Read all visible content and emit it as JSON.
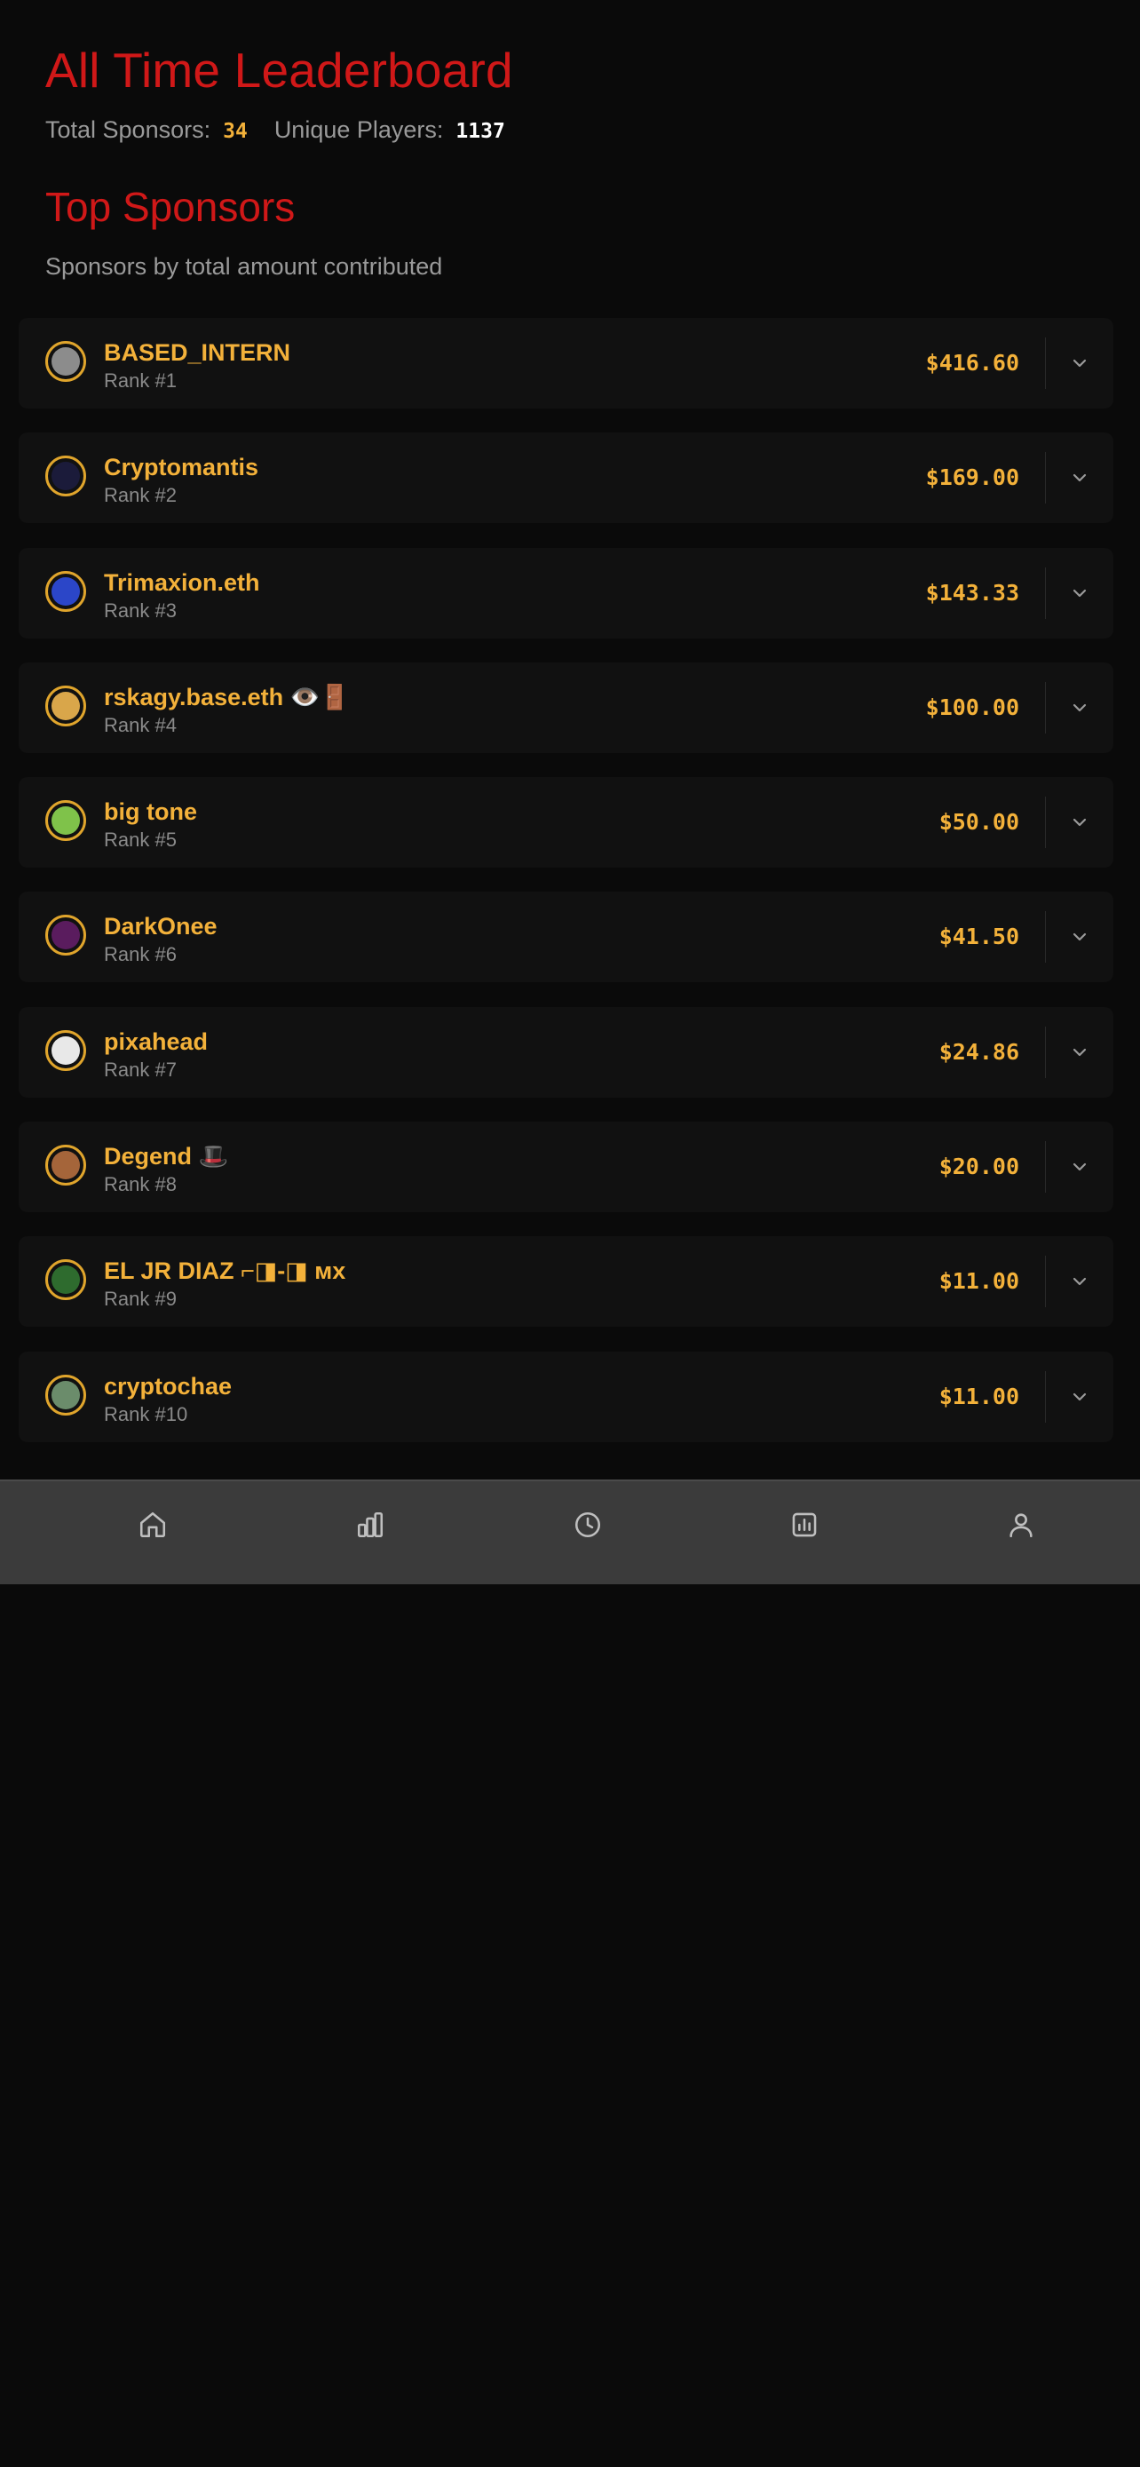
{
  "header": {
    "title": "All Time Leaderboard",
    "total_sponsors_label": "Total Sponsors:",
    "total_sponsors_value": "34",
    "unique_players_label": "Unique Players:",
    "unique_players_value": "1137"
  },
  "section": {
    "title": "Top Sponsors",
    "subtitle": "Sponsors by total amount contributed"
  },
  "sponsors": [
    {
      "name": "BASED_INTERN",
      "rank": "Rank #1",
      "amount": "$416.60",
      "avatar_color": "#8c8c8c"
    },
    {
      "name": "Cryptomantis",
      "rank": "Rank #2",
      "amount": "$169.00",
      "avatar_color": "#1b1b3a"
    },
    {
      "name": "Trimaxion.eth",
      "rank": "Rank #3",
      "amount": "$143.33",
      "avatar_color": "#2b46c8"
    },
    {
      "name": "rskagy.base.eth 👁️🚪",
      "rank": "Rank #4",
      "amount": "$100.00",
      "avatar_color": "#d9a64a"
    },
    {
      "name": "big tone",
      "rank": "Rank #5",
      "amount": "$50.00",
      "avatar_color": "#7fc24a"
    },
    {
      "name": "DarkOnee",
      "rank": "Rank #6",
      "amount": "$41.50",
      "avatar_color": "#5a1c5e"
    },
    {
      "name": "pixahead",
      "rank": "Rank #7",
      "amount": "$24.86",
      "avatar_color": "#e8e8e8"
    },
    {
      "name": "Degend 🎩",
      "rank": "Rank #8",
      "amount": "$20.00",
      "avatar_color": "#a5653a"
    },
    {
      "name": "EL JR DIAZ ⌐◨-◨ ᴍx",
      "rank": "Rank #9",
      "amount": "$11.00",
      "avatar_color": "#2e6b2e"
    },
    {
      "name": "cryptochae",
      "rank": "Rank #10",
      "amount": "$11.00",
      "avatar_color": "#6b8c6b"
    }
  ],
  "nav": [
    {
      "icon": "home-icon"
    },
    {
      "icon": "bar-chart-icon"
    },
    {
      "icon": "clock-icon"
    },
    {
      "icon": "stats-icon"
    },
    {
      "icon": "user-icon"
    }
  ],
  "colors": {
    "accent_red": "#d01818",
    "gold": "#f3b13a",
    "background": "#0a0a0a",
    "row_bg": "#111111",
    "nav_bg": "#3b3b3b"
  }
}
